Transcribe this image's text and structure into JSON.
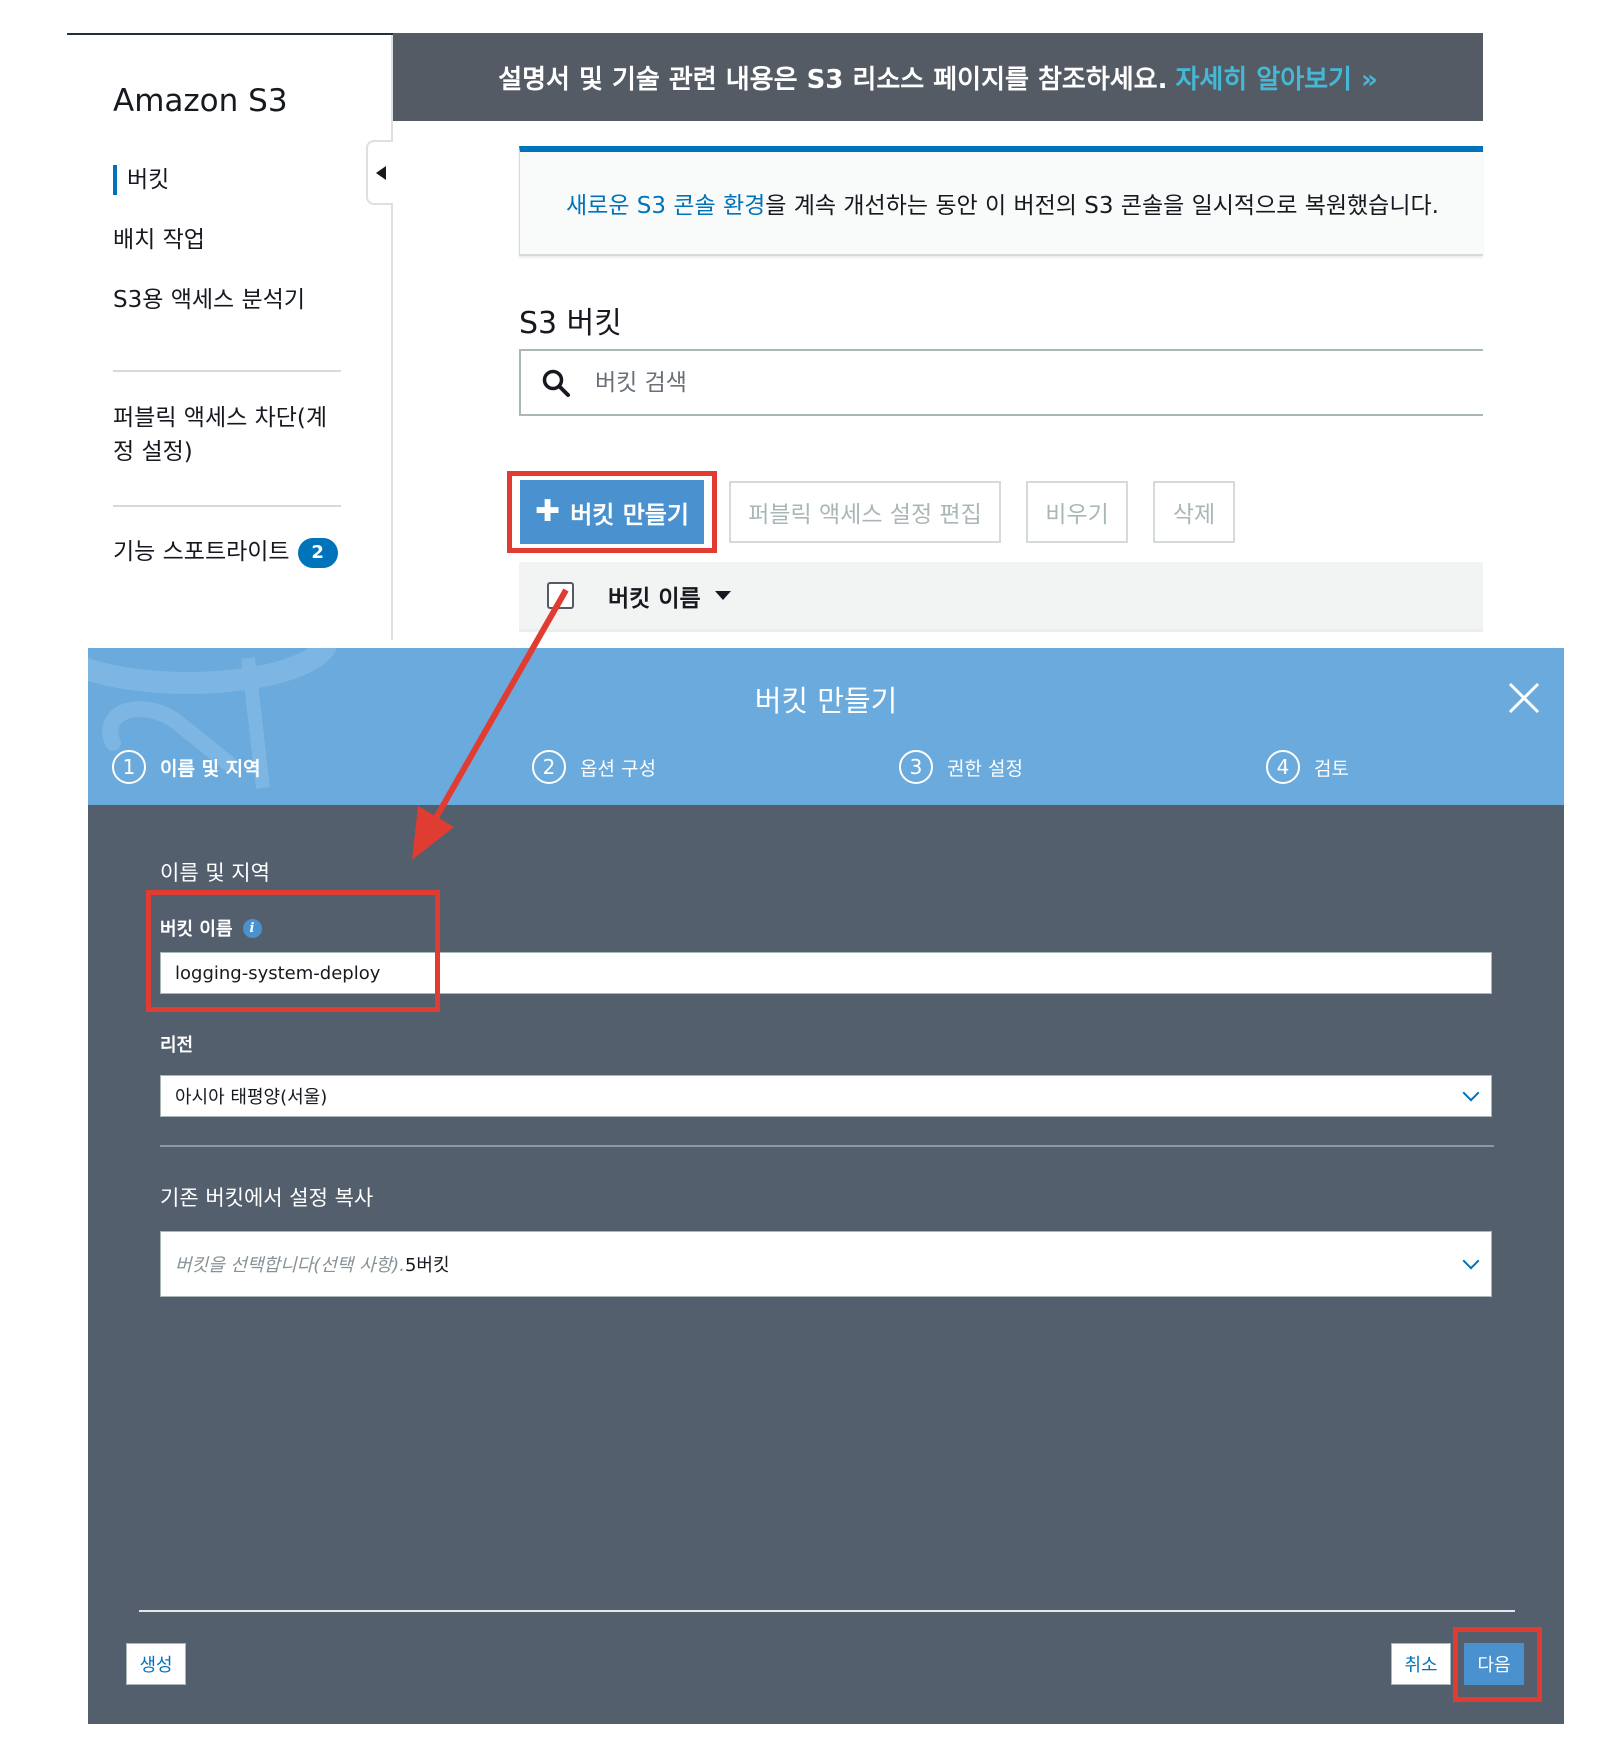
{
  "sidebar": {
    "brand": "Amazon S3",
    "items": [
      {
        "label": "버킷"
      },
      {
        "label": "배치 작업"
      },
      {
        "label": "S3용 액세스 분석기"
      },
      {
        "label_line1": "퍼블릭 액세스 차단(계",
        "label_line2": "정 설정)"
      },
      {
        "label": "기능 스포트라이트",
        "badge": "2"
      }
    ]
  },
  "banner": {
    "text": "설명서 및 기술 관련 내용은 S3 리소스 페이지를 참조하세요.",
    "link": "자세히 알아보기 »"
  },
  "flash": {
    "link": "새로운 S3 콘솔 환경",
    "text": "을 계속 개선하는 동안 이 버전의 S3 콘솔을 일시적으로 복원했습니다."
  },
  "buckets": {
    "title": "S3 버킷",
    "search_placeholder": "버킷 검색",
    "create_label": "버킷 만들기",
    "edit_public_label": "퍼블릭 액세스 설정 편집",
    "empty_label": "비우기",
    "delete_label": "삭제",
    "column_name": "버킷 이름"
  },
  "modal": {
    "title": "버킷 만들기",
    "steps": [
      {
        "num": "1",
        "label": "이름 및 지역"
      },
      {
        "num": "2",
        "label": "옵션 구성"
      },
      {
        "num": "3",
        "label": "권한 설정"
      },
      {
        "num": "4",
        "label": "검토"
      }
    ],
    "section_name_region": "이름 및 지역",
    "bucket_name_label": "버킷 이름",
    "bucket_name_value": "logging-system-deploy",
    "region_label": "리전",
    "region_value": "아시아 태평양(서울)",
    "copy_settings_label": "기존 버킷에서 설정 복사",
    "copy_settings_placeholder": "버킷을 선택합니다(선택 사항).",
    "copy_settings_count": "5버킷",
    "create_button": "생성",
    "cancel_button": "취소",
    "next_button": "다음"
  },
  "colors": {
    "accent_blue": "#0073bb",
    "modal_header": "#6aaadc",
    "modal_body": "#545f6e",
    "banner": "#545b64",
    "highlight_red": "#e03c31"
  }
}
